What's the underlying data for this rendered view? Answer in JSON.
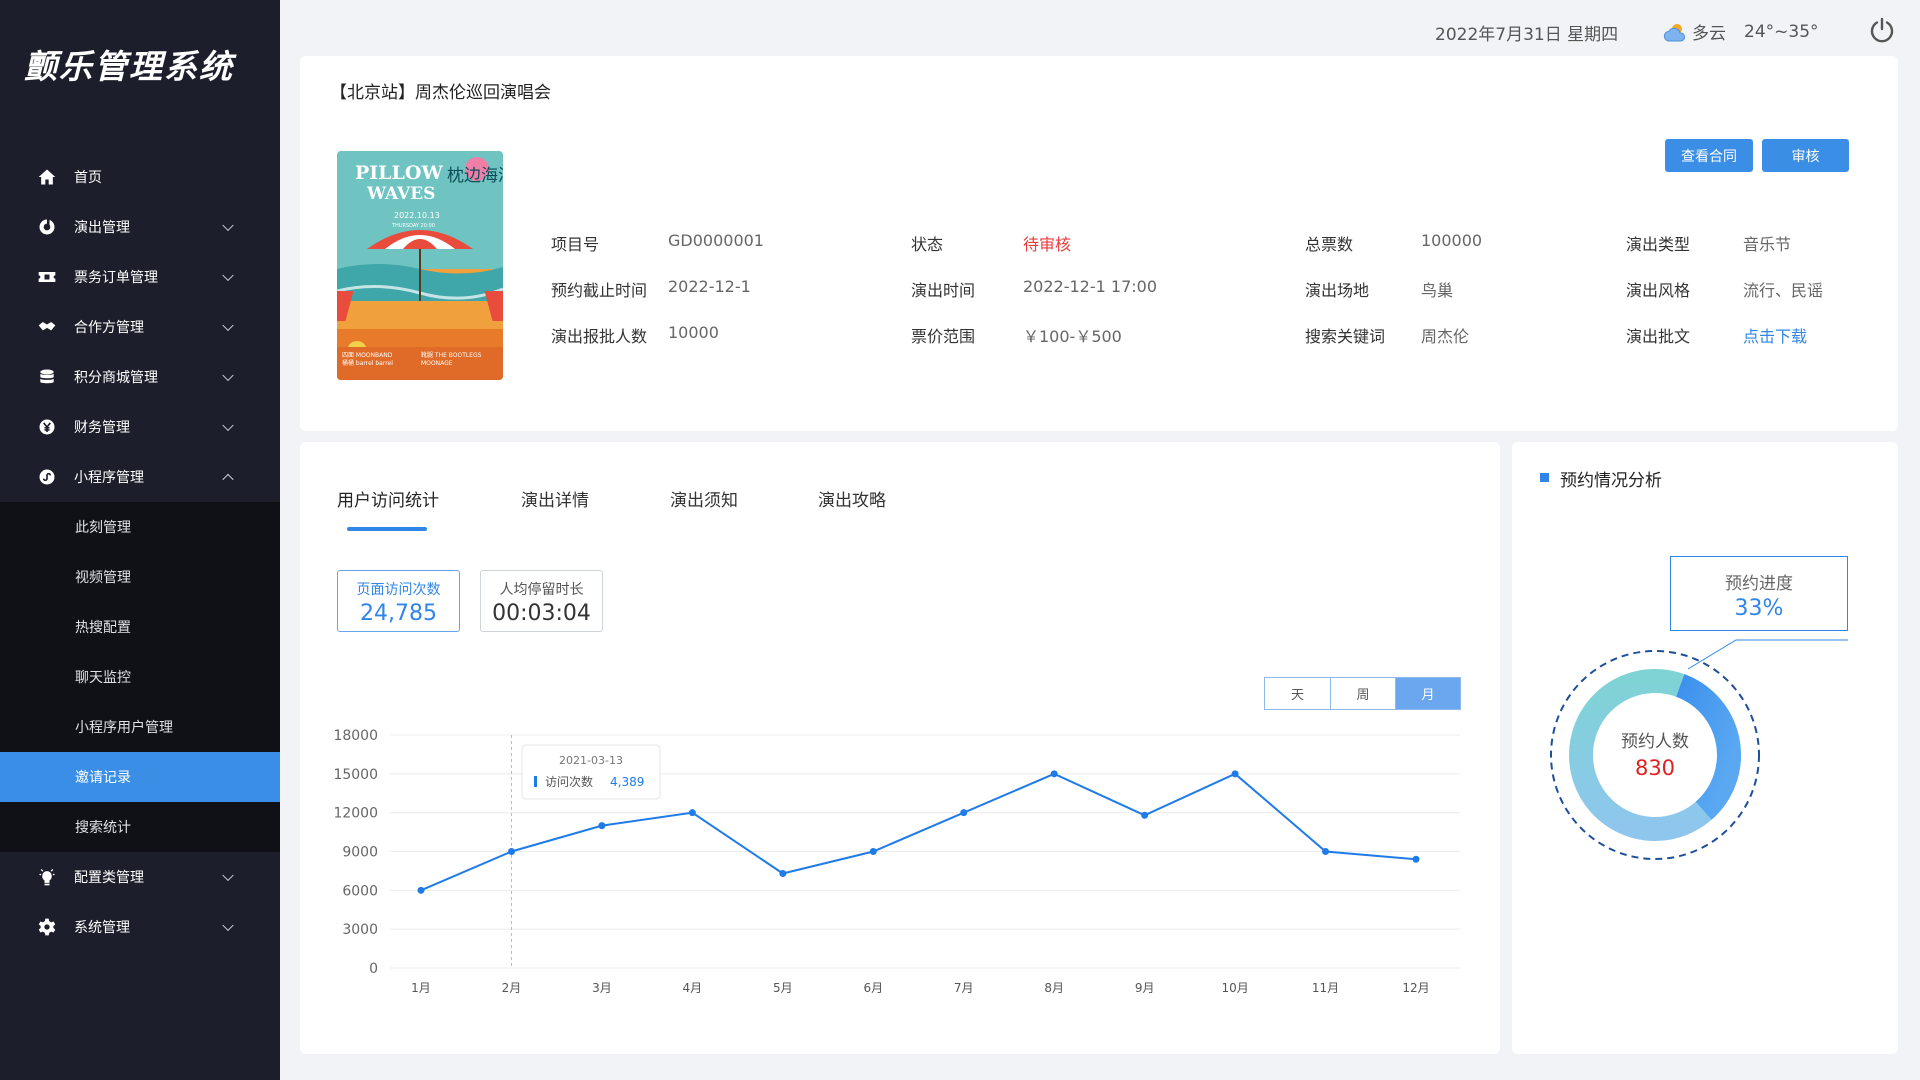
{
  "app": {
    "title": "颤乐管理系统"
  },
  "sidebar": {
    "items": [
      {
        "label": "首页",
        "icon": "home-icon"
      },
      {
        "label": "演出管理",
        "icon": "performance-icon"
      },
      {
        "label": "票务订单管理",
        "icon": "ticket-icon"
      },
      {
        "label": "合作方管理",
        "icon": "handshake-icon"
      },
      {
        "label": "积分商城管理",
        "icon": "database-icon"
      },
      {
        "label": "财务管理",
        "icon": "yen-icon"
      },
      {
        "label": "小程序管理",
        "icon": "miniprogram-icon"
      }
    ],
    "sub_items": [
      "此刻管理",
      "视频管理",
      "热搜配置",
      "聊天监控",
      "小程序用户管理",
      "邀请记录",
      "搜索统计"
    ],
    "bottom_items": [
      {
        "label": "配置类管理",
        "icon": "bulb-icon"
      },
      {
        "label": "系统管理",
        "icon": "gear-icon"
      }
    ]
  },
  "header": {
    "date": "2022年7月31日  星期四",
    "weather": "多云",
    "temperature": "24°~35°"
  },
  "event": {
    "title": "【北京站】周杰伦巡回演唱会",
    "buttons": {
      "contract": "查看合同",
      "review": "审核"
    },
    "fields": {
      "project_no_label": "项目号",
      "project_no": "GD0000001",
      "status_label": "状态",
      "status": "待审核",
      "total_tickets_label": "总票数",
      "total_tickets": "100000",
      "type_label": "演出类型",
      "type": "音乐节",
      "deadline_label": "预约截止时间",
      "deadline": "2022-12-1",
      "show_time_label": "演出时间",
      "show_time": "2022-12-1  17:00",
      "venue_label": "演出场地",
      "venue": "鸟巢",
      "style_label": "演出风格",
      "style": "流行、民谣",
      "approved_count_label": "演出报批人数",
      "approved_count": "10000",
      "price_label": "票价范围",
      "price": "￥100-￥500",
      "keyword_label": "搜索关键词",
      "keyword": "周杰伦",
      "permit_label": "演出批文",
      "permit": "点击下载"
    },
    "poster": {
      "line1": "PILLOW",
      "line2": "WAVES",
      "cn": "枕边海浪",
      "date": "2022.10.13",
      "day": "THURSDAY 20:00",
      "bands_left": "四面 MOONBAND",
      "bands_left2": "桶桶 barrel barrel",
      "bands_right": "靴腿 THE BOOTLEGS",
      "bands_right2": "MOONAGE"
    }
  },
  "tabs": [
    "用户访问统计",
    "演出详情",
    "演出须知",
    "演出攻略"
  ],
  "stats": [
    {
      "label": "页面访问次数",
      "value": "24,785"
    },
    {
      "label": "人均停留时长",
      "value": "00:03:04"
    }
  ],
  "range_toggle": [
    "天",
    "周",
    "月"
  ],
  "chart_data": {
    "type": "line",
    "categories": [
      "1月",
      "2月",
      "3月",
      "4月",
      "5月",
      "6月",
      "7月",
      "8月",
      "9月",
      "10月",
      "11月",
      "12月"
    ],
    "series": [
      {
        "values": [
          6000,
          9000,
          11000,
          12000,
          7300,
          9000,
          12000,
          15000,
          11800,
          15000,
          9000,
          8400
        ]
      }
    ],
    "ylim": [
      0,
      18000
    ],
    "yticks": [
      0,
      3000,
      6000,
      9000,
      12000,
      15000,
      18000
    ],
    "grid": true,
    "tooltip": {
      "date": "2021-03-13",
      "label": "访问次数",
      "value": "4,389"
    },
    "color": "#1f7be8"
  },
  "booking": {
    "title": "预约情况分析",
    "progress_label": "预约进度",
    "progress_value": "33%",
    "count_label": "预约人数",
    "count_value": "830",
    "progress_fraction": 0.33
  }
}
